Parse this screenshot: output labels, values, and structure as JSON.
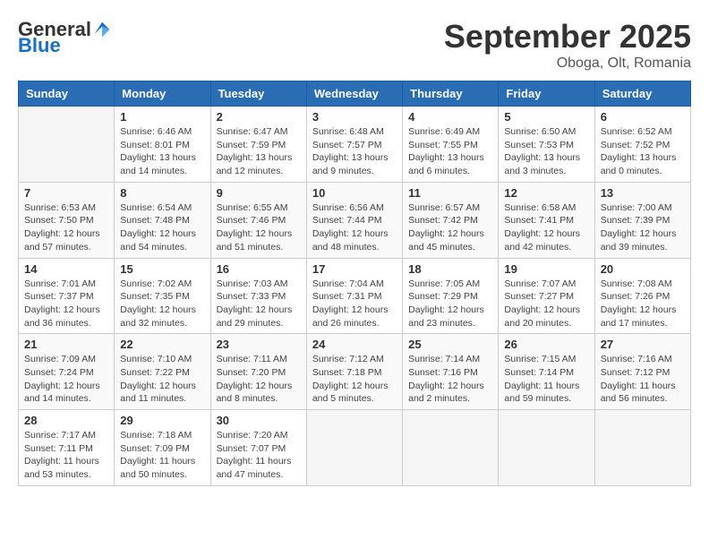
{
  "logo": {
    "general": "General",
    "blue": "Blue"
  },
  "title": {
    "month": "September 2025",
    "location": "Oboga, Olt, Romania"
  },
  "headers": [
    "Sunday",
    "Monday",
    "Tuesday",
    "Wednesday",
    "Thursday",
    "Friday",
    "Saturday"
  ],
  "weeks": [
    [
      {
        "day": "",
        "info": ""
      },
      {
        "day": "1",
        "info": "Sunrise: 6:46 AM\nSunset: 8:01 PM\nDaylight: 13 hours\nand 14 minutes."
      },
      {
        "day": "2",
        "info": "Sunrise: 6:47 AM\nSunset: 7:59 PM\nDaylight: 13 hours\nand 12 minutes."
      },
      {
        "day": "3",
        "info": "Sunrise: 6:48 AM\nSunset: 7:57 PM\nDaylight: 13 hours\nand 9 minutes."
      },
      {
        "day": "4",
        "info": "Sunrise: 6:49 AM\nSunset: 7:55 PM\nDaylight: 13 hours\nand 6 minutes."
      },
      {
        "day": "5",
        "info": "Sunrise: 6:50 AM\nSunset: 7:53 PM\nDaylight: 13 hours\nand 3 minutes."
      },
      {
        "day": "6",
        "info": "Sunrise: 6:52 AM\nSunset: 7:52 PM\nDaylight: 13 hours\nand 0 minutes."
      }
    ],
    [
      {
        "day": "7",
        "info": "Sunrise: 6:53 AM\nSunset: 7:50 PM\nDaylight: 12 hours\nand 57 minutes."
      },
      {
        "day": "8",
        "info": "Sunrise: 6:54 AM\nSunset: 7:48 PM\nDaylight: 12 hours\nand 54 minutes."
      },
      {
        "day": "9",
        "info": "Sunrise: 6:55 AM\nSunset: 7:46 PM\nDaylight: 12 hours\nand 51 minutes."
      },
      {
        "day": "10",
        "info": "Sunrise: 6:56 AM\nSunset: 7:44 PM\nDaylight: 12 hours\nand 48 minutes."
      },
      {
        "day": "11",
        "info": "Sunrise: 6:57 AM\nSunset: 7:42 PM\nDaylight: 12 hours\nand 45 minutes."
      },
      {
        "day": "12",
        "info": "Sunrise: 6:58 AM\nSunset: 7:41 PM\nDaylight: 12 hours\nand 42 minutes."
      },
      {
        "day": "13",
        "info": "Sunrise: 7:00 AM\nSunset: 7:39 PM\nDaylight: 12 hours\nand 39 minutes."
      }
    ],
    [
      {
        "day": "14",
        "info": "Sunrise: 7:01 AM\nSunset: 7:37 PM\nDaylight: 12 hours\nand 36 minutes."
      },
      {
        "day": "15",
        "info": "Sunrise: 7:02 AM\nSunset: 7:35 PM\nDaylight: 12 hours\nand 32 minutes."
      },
      {
        "day": "16",
        "info": "Sunrise: 7:03 AM\nSunset: 7:33 PM\nDaylight: 12 hours\nand 29 minutes."
      },
      {
        "day": "17",
        "info": "Sunrise: 7:04 AM\nSunset: 7:31 PM\nDaylight: 12 hours\nand 26 minutes."
      },
      {
        "day": "18",
        "info": "Sunrise: 7:05 AM\nSunset: 7:29 PM\nDaylight: 12 hours\nand 23 minutes."
      },
      {
        "day": "19",
        "info": "Sunrise: 7:07 AM\nSunset: 7:27 PM\nDaylight: 12 hours\nand 20 minutes."
      },
      {
        "day": "20",
        "info": "Sunrise: 7:08 AM\nSunset: 7:26 PM\nDaylight: 12 hours\nand 17 minutes."
      }
    ],
    [
      {
        "day": "21",
        "info": "Sunrise: 7:09 AM\nSunset: 7:24 PM\nDaylight: 12 hours\nand 14 minutes."
      },
      {
        "day": "22",
        "info": "Sunrise: 7:10 AM\nSunset: 7:22 PM\nDaylight: 12 hours\nand 11 minutes."
      },
      {
        "day": "23",
        "info": "Sunrise: 7:11 AM\nSunset: 7:20 PM\nDaylight: 12 hours\nand 8 minutes."
      },
      {
        "day": "24",
        "info": "Sunrise: 7:12 AM\nSunset: 7:18 PM\nDaylight: 12 hours\nand 5 minutes."
      },
      {
        "day": "25",
        "info": "Sunrise: 7:14 AM\nSunset: 7:16 PM\nDaylight: 12 hours\nand 2 minutes."
      },
      {
        "day": "26",
        "info": "Sunrise: 7:15 AM\nSunset: 7:14 PM\nDaylight: 11 hours\nand 59 minutes."
      },
      {
        "day": "27",
        "info": "Sunrise: 7:16 AM\nSunset: 7:12 PM\nDaylight: 11 hours\nand 56 minutes."
      }
    ],
    [
      {
        "day": "28",
        "info": "Sunrise: 7:17 AM\nSunset: 7:11 PM\nDaylight: 11 hours\nand 53 minutes."
      },
      {
        "day": "29",
        "info": "Sunrise: 7:18 AM\nSunset: 7:09 PM\nDaylight: 11 hours\nand 50 minutes."
      },
      {
        "day": "30",
        "info": "Sunrise: 7:20 AM\nSunset: 7:07 PM\nDaylight: 11 hours\nand 47 minutes."
      },
      {
        "day": "",
        "info": ""
      },
      {
        "day": "",
        "info": ""
      },
      {
        "day": "",
        "info": ""
      },
      {
        "day": "",
        "info": ""
      }
    ]
  ]
}
